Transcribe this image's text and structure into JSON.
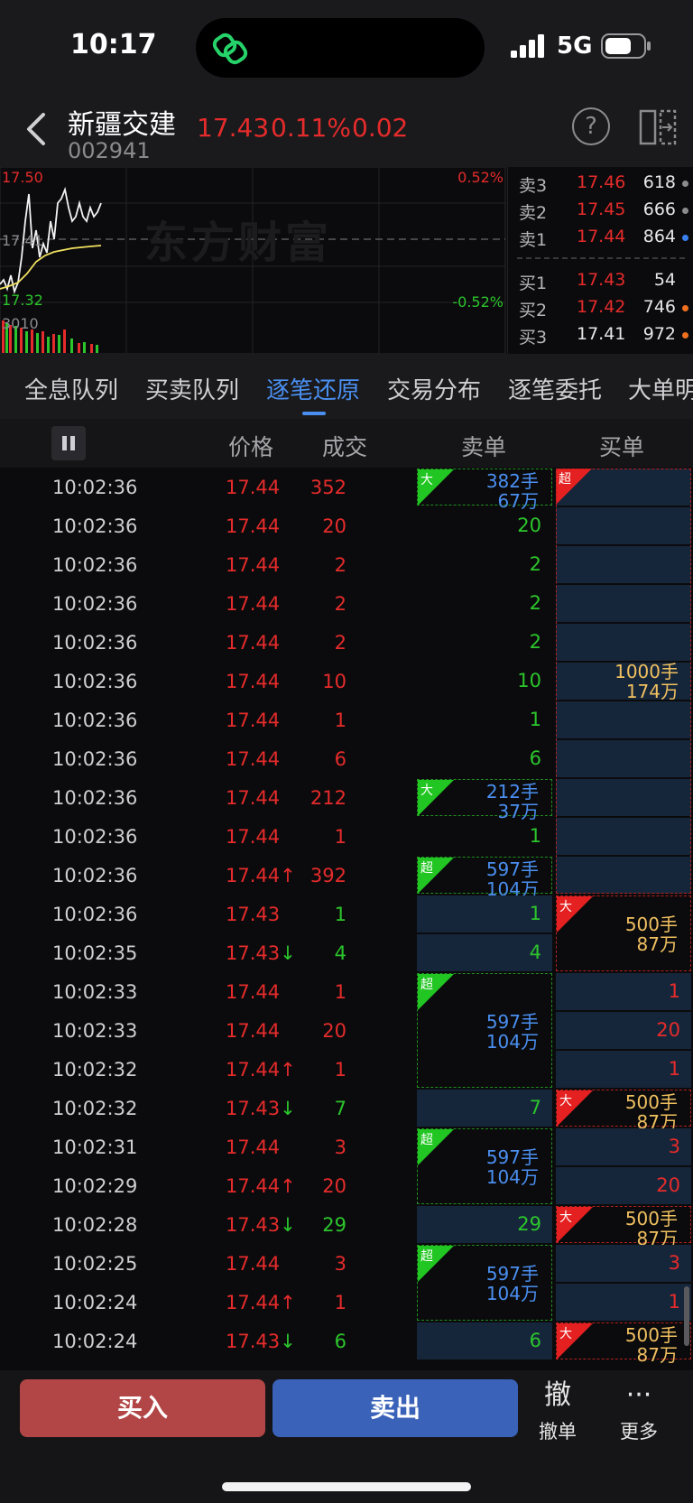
{
  "status_bar": {
    "time": "10:17",
    "network": "5G"
  },
  "header": {
    "name": "新疆交建",
    "code": "002941",
    "price": "17.43",
    "change_pct": "0.11%",
    "change": "0.02",
    "help_glyph": "?"
  },
  "mini_chart": {
    "top_price": "17.50",
    "mid_price": "17.41",
    "low_price": "17.32",
    "volume": "3010",
    "pct_top": "0.52%",
    "pct_low": "-0.52%",
    "watermark": "东方财富"
  },
  "order_book": {
    "asks": [
      {
        "label": "卖3",
        "price": "17.46",
        "volume": "618",
        "dot": "#8a8a8f"
      },
      {
        "label": "卖2",
        "price": "17.45",
        "volume": "666",
        "dot": "#8a8a8f"
      },
      {
        "label": "卖1",
        "price": "17.44",
        "volume": "864",
        "dot": "#3a7ff0"
      }
    ],
    "bids": [
      {
        "label": "买1",
        "price": "17.43",
        "volume": "54",
        "dot": ""
      },
      {
        "label": "买2",
        "price": "17.42",
        "volume": "746",
        "dot": "#f07020"
      },
      {
        "label": "买3",
        "price": "17.41",
        "volume": "972",
        "dot": "#f07020"
      }
    ]
  },
  "tabs": [
    {
      "label": "全息队列",
      "active": false
    },
    {
      "label": "买卖队列",
      "active": false
    },
    {
      "label": "逐笔还原",
      "active": true
    },
    {
      "label": "交易分布",
      "active": false
    },
    {
      "label": "逐笔委托",
      "active": false
    },
    {
      "label": "大单明细",
      "active": false
    }
  ],
  "table_header": {
    "price": "价格",
    "volume": "成交",
    "sell": "卖单",
    "buy": "买单"
  },
  "trades": [
    {
      "time": "10:02:36",
      "price": "17.44",
      "arrow": "",
      "volume": "352",
      "color": "red"
    },
    {
      "time": "10:02:36",
      "price": "17.44",
      "arrow": "",
      "volume": "20",
      "color": "red"
    },
    {
      "time": "10:02:36",
      "price": "17.44",
      "arrow": "",
      "volume": "2",
      "color": "red"
    },
    {
      "time": "10:02:36",
      "price": "17.44",
      "arrow": "",
      "volume": "2",
      "color": "red"
    },
    {
      "time": "10:02:36",
      "price": "17.44",
      "arrow": "",
      "volume": "2",
      "color": "red"
    },
    {
      "time": "10:02:36",
      "price": "17.44",
      "arrow": "",
      "volume": "10",
      "color": "red"
    },
    {
      "time": "10:02:36",
      "price": "17.44",
      "arrow": "",
      "volume": "1",
      "color": "red"
    },
    {
      "time": "10:02:36",
      "price": "17.44",
      "arrow": "",
      "volume": "6",
      "color": "red"
    },
    {
      "time": "10:02:36",
      "price": "17.44",
      "arrow": "",
      "volume": "212",
      "color": "red"
    },
    {
      "time": "10:02:36",
      "price": "17.44",
      "arrow": "",
      "volume": "1",
      "color": "red"
    },
    {
      "time": "10:02:36",
      "price": "17.44",
      "arrow": "↑",
      "volume": "392",
      "color": "red"
    },
    {
      "time": "10:02:36",
      "price": "17.43",
      "arrow": "",
      "volume": "1",
      "color": "green"
    },
    {
      "time": "10:02:35",
      "price": "17.43",
      "arrow": "↓",
      "volume": "4",
      "color": "green"
    },
    {
      "time": "10:02:33",
      "price": "17.44",
      "arrow": "",
      "volume": "1",
      "color": "red"
    },
    {
      "time": "10:02:33",
      "price": "17.44",
      "arrow": "",
      "volume": "20",
      "color": "red"
    },
    {
      "time": "10:02:32",
      "price": "17.44",
      "arrow": "↑",
      "volume": "1",
      "color": "red"
    },
    {
      "time": "10:02:32",
      "price": "17.43",
      "arrow": "↓",
      "volume": "7",
      "color": "green"
    },
    {
      "time": "10:02:31",
      "price": "17.44",
      "arrow": "",
      "volume": "3",
      "color": "red"
    },
    {
      "time": "10:02:29",
      "price": "17.44",
      "arrow": "↑",
      "volume": "20",
      "color": "red"
    },
    {
      "time": "10:02:28",
      "price": "17.43",
      "arrow": "↓",
      "volume": "29",
      "color": "green"
    },
    {
      "time": "10:02:25",
      "price": "17.44",
      "arrow": "",
      "volume": "3",
      "color": "red"
    },
    {
      "time": "10:02:24",
      "price": "17.44",
      "arrow": "↑",
      "volume": "1",
      "color": "red"
    },
    {
      "time": "10:02:24",
      "price": "17.43",
      "arrow": "↓",
      "volume": "6",
      "color": "green"
    }
  ],
  "sell_orders": [
    {
      "rows": [
        0
      ],
      "type": "大",
      "lots": "382手",
      "amount": "67万",
      "partial_top": true
    },
    {
      "rows": [
        1
      ],
      "value": "20"
    },
    {
      "rows": [
        2
      ],
      "value": "2"
    },
    {
      "rows": [
        3
      ],
      "value": "2"
    },
    {
      "rows": [
        4
      ],
      "value": "2"
    },
    {
      "rows": [
        5
      ],
      "value": "10"
    },
    {
      "rows": [
        6
      ],
      "value": "1"
    },
    {
      "rows": [
        7
      ],
      "value": "6"
    },
    {
      "rows": [
        8
      ],
      "type": "大",
      "lots": "212手",
      "amount": "37万"
    },
    {
      "rows": [
        9
      ],
      "value": "1"
    },
    {
      "rows": [
        10
      ],
      "type": "超",
      "lots": "597手",
      "amount": "104万"
    },
    {
      "rows": [
        11
      ],
      "value": "1",
      "filled": true
    },
    {
      "rows": [
        12
      ],
      "value": "4",
      "filled": true
    },
    {
      "rows": [
        13,
        14,
        15
      ],
      "type": "超",
      "lots": "597手",
      "amount": "104万"
    },
    {
      "rows": [
        16
      ],
      "value": "7",
      "filled": true
    },
    {
      "rows": [
        17,
        18
      ],
      "type": "超",
      "lots": "597手",
      "amount": "104万"
    },
    {
      "rows": [
        19
      ],
      "value": "29",
      "filled": true
    },
    {
      "rows": [
        20,
        21
      ],
      "type": "超",
      "lots": "597手",
      "amount": "104万"
    },
    {
      "rows": [
        22
      ],
      "value": "6",
      "filled": true
    }
  ],
  "buy_orders": [
    {
      "rows": [
        0,
        1,
        2,
        3,
        4,
        5,
        6,
        7,
        8,
        9,
        10
      ],
      "type": "超",
      "lots": "1000手",
      "amount": "174万"
    },
    {
      "rows": [
        11,
        12
      ],
      "type": "大",
      "lots": "500手",
      "amount": "87万"
    },
    {
      "rows": [
        13
      ],
      "value": "1",
      "filled": true
    },
    {
      "rows": [
        14
      ],
      "value": "20",
      "filled": true
    },
    {
      "rows": [
        15
      ],
      "value": "1",
      "filled": true
    },
    {
      "rows": [
        16
      ],
      "type": "大",
      "lots": "500手",
      "amount": "87万"
    },
    {
      "rows": [
        17
      ],
      "value": "3",
      "filled": true
    },
    {
      "rows": [
        18
      ],
      "value": "20",
      "filled": true
    },
    {
      "rows": [
        19
      ],
      "type": "大",
      "lots": "500手",
      "amount": "87万"
    },
    {
      "rows": [
        20
      ],
      "value": "3",
      "filled": true
    },
    {
      "rows": [
        21
      ],
      "value": "1",
      "filled": true
    },
    {
      "rows": [
        22
      ],
      "type": "大",
      "lots": "500手",
      "amount": "87万"
    }
  ],
  "bottom_bar": {
    "buy_label": "买入",
    "sell_label": "卖出",
    "cancel_glyph": "撤",
    "cancel_label": "撤单",
    "more_glyph": "···",
    "more_label": "更多"
  },
  "colors": {
    "red": "#e52b2b",
    "green": "#2cc52c",
    "blue": "#4a8ff0",
    "gold": "#f0c060",
    "buy_button": "#b24545",
    "sell_button": "#3a62b8"
  }
}
